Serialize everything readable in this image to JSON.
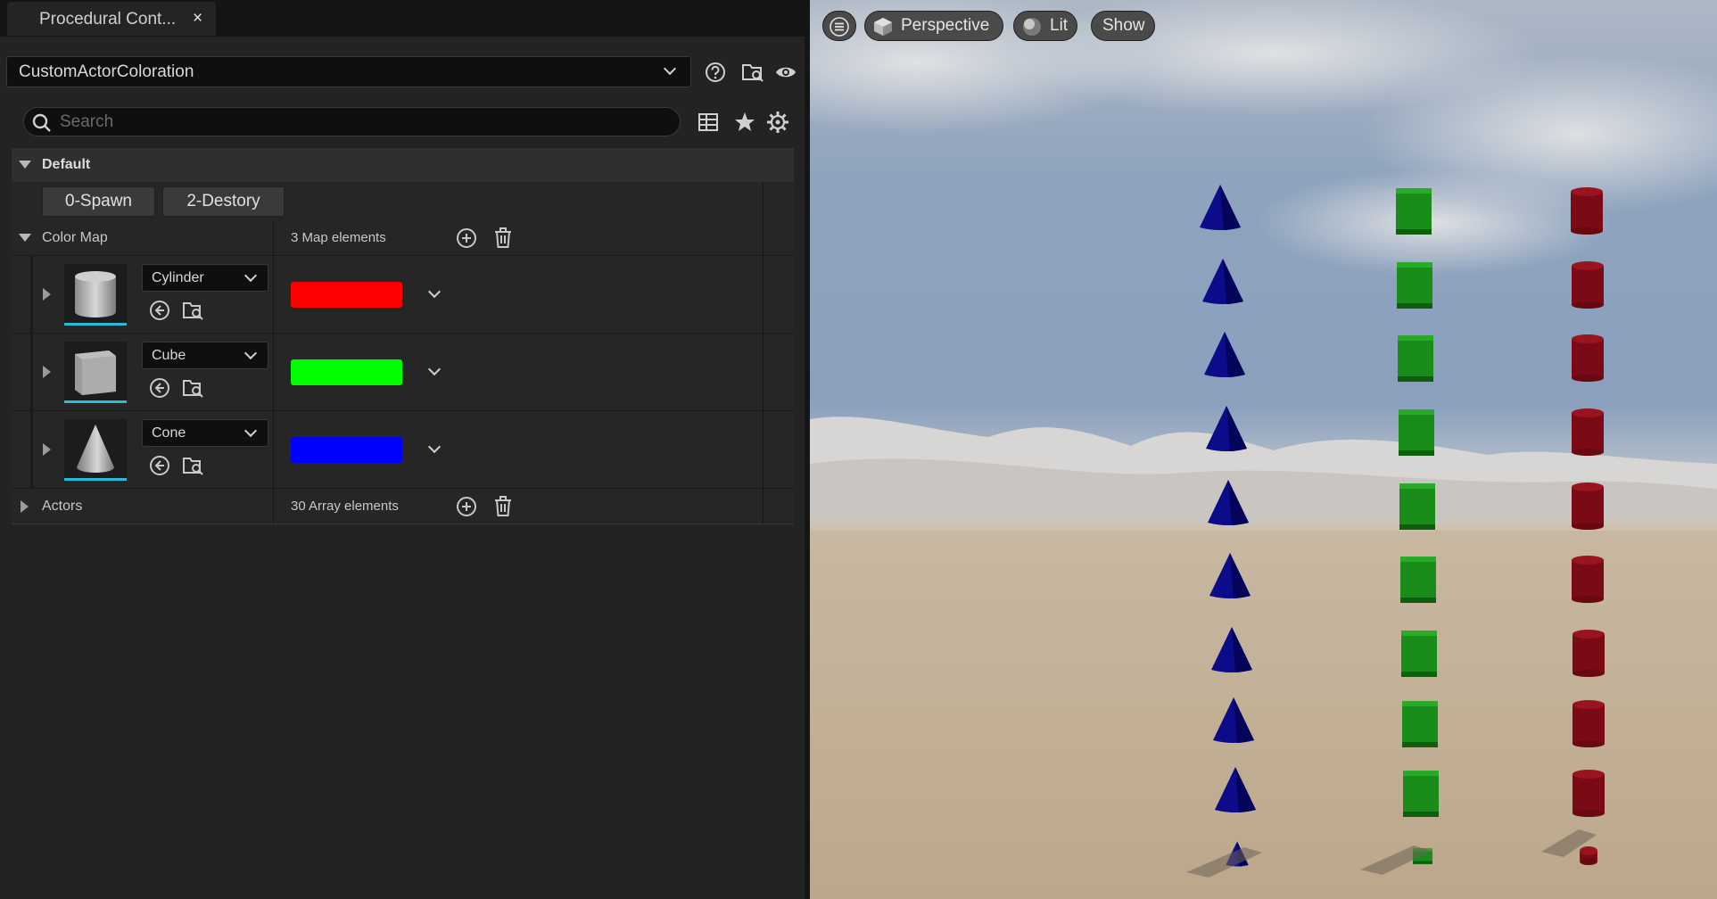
{
  "tab": {
    "title": "Procedural Cont...",
    "close": "×"
  },
  "selector": {
    "value": "CustomActorColoration"
  },
  "search": {
    "placeholder": "Search"
  },
  "category": {
    "label": "Default"
  },
  "buttons": {
    "spawn": "0-Spawn",
    "destroy": "2-Destory"
  },
  "color_map": {
    "label": "Color Map",
    "summary": "3 Map elements",
    "entries": [
      {
        "key": "Cylinder",
        "color": "#ff0000"
      },
      {
        "key": "Cube",
        "color": "#00ff00"
      },
      {
        "key": "Cone",
        "color": "#0000ff"
      }
    ]
  },
  "actors": {
    "label": "Actors",
    "summary": "30 Array elements"
  },
  "viewport": {
    "perspective": "Perspective",
    "lit": "Lit",
    "show": "Show"
  },
  "colors": {
    "accent": "#26bbd9",
    "panel": "#232323",
    "red": "#7a0a16",
    "green": "#1a8a1a",
    "blue": "#0a0a7a"
  },
  "icons": [
    "help-icon",
    "browse-folder-icon",
    "eye-icon",
    "search-icon",
    "table-view-icon",
    "star-icon",
    "gear-icon",
    "add-icon",
    "trash-icon",
    "use-selected-icon",
    "hamburger-icon",
    "cube-icon",
    "lit-sphere-icon"
  ]
}
